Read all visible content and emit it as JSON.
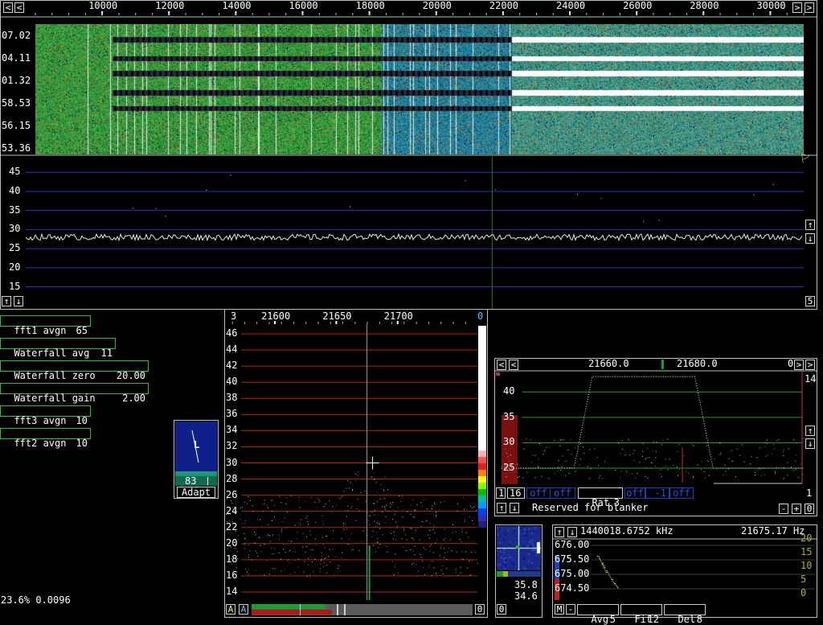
{
  "colors": {
    "grid_blue": "#1f2fc0",
    "grid_red": "#b22020",
    "grid_green": "#1aa02a",
    "afc_box": "#2fbf3a",
    "accent_cyan": "#40c8ff"
  },
  "main_spectrum": {
    "x_ticks": [
      "10000",
      "12000",
      "14000",
      "16000",
      "18000",
      "20000",
      "22000",
      "24000",
      "26000",
      "28000",
      "30000"
    ],
    "time_labels": [
      "07.02",
      "04.11",
      "01.32",
      "58.53",
      "56.15",
      "53.36"
    ],
    "db_labels": [
      "45",
      "40",
      "35",
      "30",
      "25",
      "20",
      "15"
    ],
    "scroll_count": "5",
    "chart_data": {
      "type": "line",
      "title": "",
      "xlabel": "",
      "ylabel": "",
      "x_range": [
        8000,
        31000
      ],
      "ylim": [
        13,
        48
      ],
      "baseline_db": 28,
      "cursor_hz": 21675
    }
  },
  "params": [
    {
      "label": "fft1 avgn",
      "value": "65"
    },
    {
      "label": "Waterfall avg",
      "value": "11"
    },
    {
      "label": "Waterfall zero",
      "value": "20.00"
    },
    {
      "label": "Waterfall gain",
      "value": "2.00"
    },
    {
      "label": "fft3 avgn",
      "value": "10"
    },
    {
      "label": "fft2 avgn",
      "value": "10"
    }
  ],
  "status_left": "23.6% 0.0096",
  "small_meter": {
    "letter": "L",
    "value": "83",
    "adapt_label": "Adapt"
  },
  "baseband": {
    "corner_left": "3",
    "corner_right": "0",
    "x_ticks": [
      "21600",
      "21650",
      "21700"
    ],
    "y_labels": [
      "46",
      "44",
      "42",
      "40",
      "38",
      "36",
      "34",
      "32",
      "30",
      "28",
      "26",
      "24",
      "22",
      "20",
      "18",
      "16",
      "14"
    ],
    "btn_a1": "A",
    "btn_a2": "A",
    "btn_zero": "0",
    "chart_data": {
      "type": "scatter",
      "title": "",
      "xlabel": "",
      "ylabel": "",
      "x_range": [
        21560,
        21765
      ],
      "ylim": [
        13,
        47
      ],
      "signal_hz": 21675
    }
  },
  "afc": {
    "freq_left": "21660.0",
    "freq_right": "21680.0",
    "corner_right": "0",
    "right_label": "14",
    "db_labels": [
      "40",
      "35",
      "30",
      "25"
    ],
    "count_left": "1",
    "btn_16": "16",
    "off1": "off",
    "off2": "off",
    "rat_label": "Rat",
    "rat_value": "3",
    "off3": "off",
    "dash_value": "-1",
    "off4": "off",
    "right_num": "1",
    "reserved_text": "Reserved for blanker",
    "btn_minus": "-",
    "btn_plus": "+",
    "btn_zero": "0",
    "chart_data": {
      "type": "line",
      "title": "",
      "xlabel": "",
      "ylabel": "",
      "x_range": [
        21648,
        21698
      ],
      "ylim": [
        22,
        44
      ]
    }
  },
  "smeter": {
    "freq_khz": "1440018.6752 kHz",
    "freq_hz": "21675.17 Hz",
    "freq_labels": [
      "676.00",
      "675.50",
      "675.00",
      "674.50"
    ],
    "right_labels": [
      "20",
      "15",
      "10",
      "5",
      "0"
    ],
    "mini_v1": "35.8",
    "mini_v2": "34.6",
    "mini_zero": "0",
    "btn_m": "M",
    "btn_dash": "-",
    "avg_label": "Avg",
    "avg_value": "5",
    "fit_label": "Fit",
    "fit_value": "12",
    "del_label": "Del",
    "del_value": "8"
  }
}
